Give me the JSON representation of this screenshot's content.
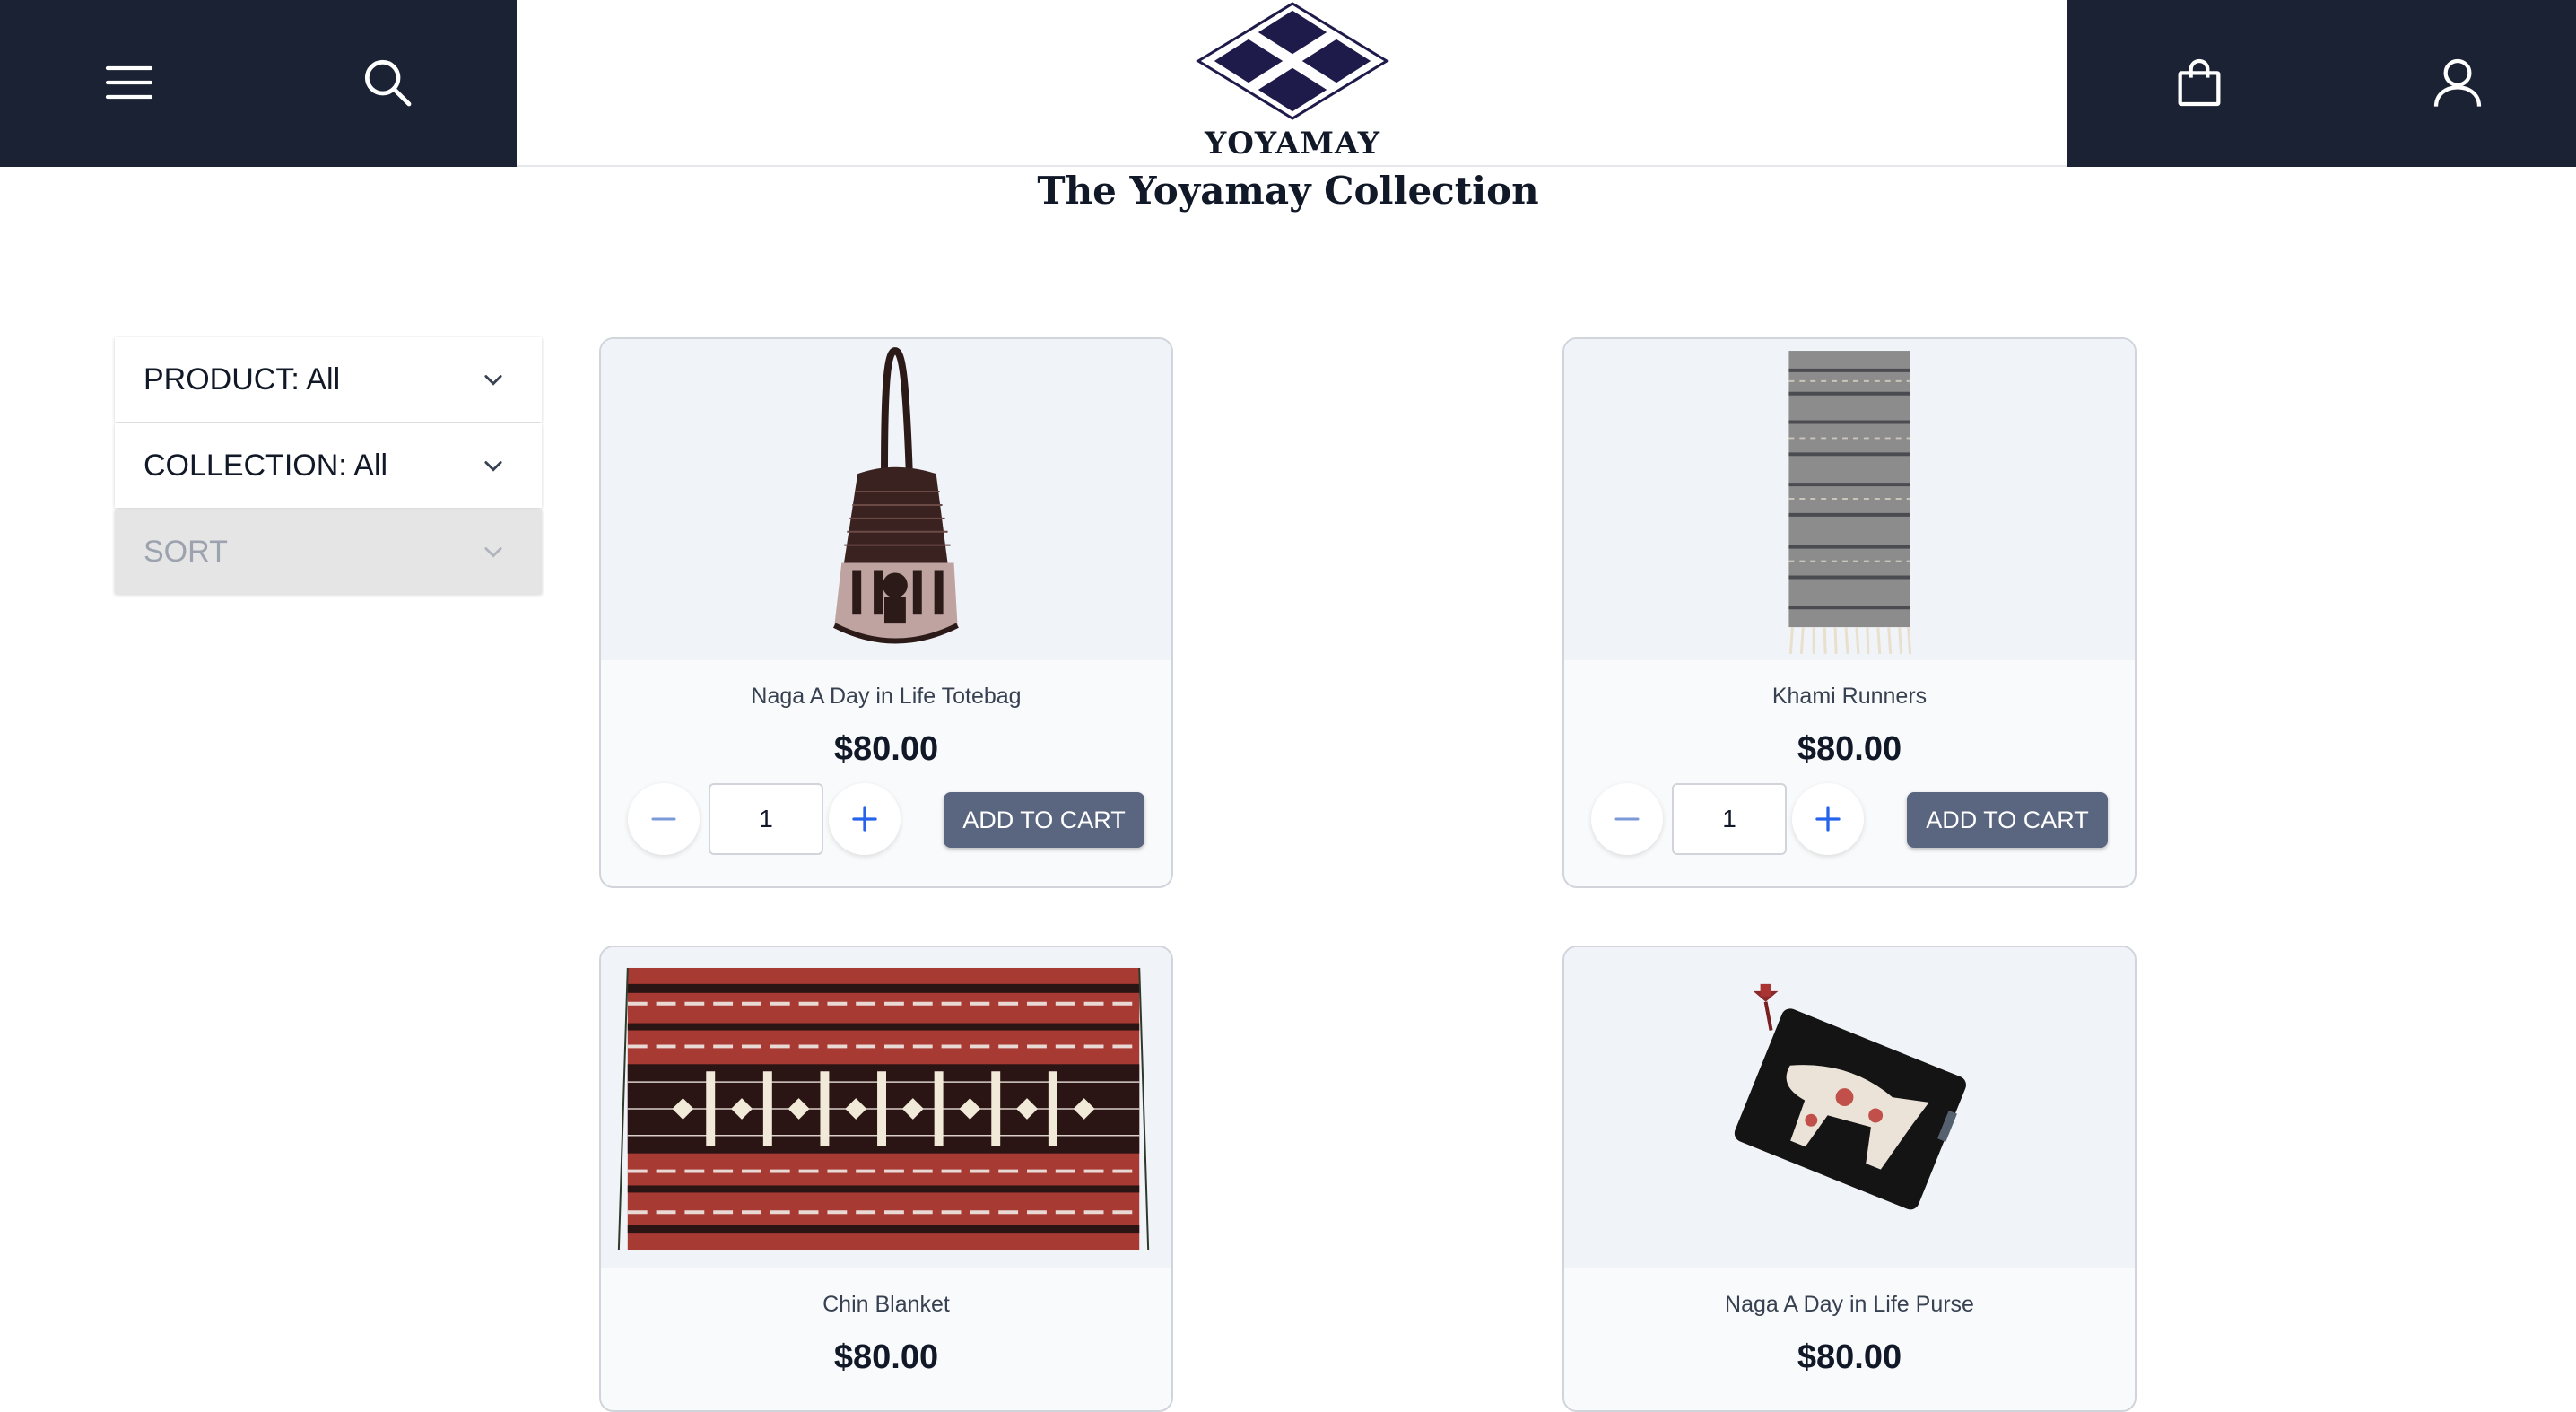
{
  "brand": {
    "name": "YOYAMAY"
  },
  "page": {
    "title": "The Yoyamay Collection"
  },
  "header": {
    "icons": [
      "menu-icon",
      "search-icon",
      "shopping-bag-icon",
      "user-icon"
    ]
  },
  "filters": {
    "product": "PRODUCT: All",
    "collection": "COLLECTION: All",
    "sort": "SORT"
  },
  "products": [
    {
      "name": "Naga A Day in Life Totebag",
      "price": "$80.00",
      "quantity": "1",
      "add_label": "ADD TO CART"
    },
    {
      "name": "Khami Runners",
      "price": "$80.00",
      "quantity": "1",
      "add_label": "ADD TO CART"
    },
    {
      "name": "Chin Blanket",
      "price": "$80.00"
    },
    {
      "name": "Naga A Day in Life Purse",
      "price": "$80.00"
    }
  ],
  "colors": {
    "header_dark": "#1a2233",
    "button": "#5a6680",
    "card_image_bg": "#f0f3f8"
  }
}
